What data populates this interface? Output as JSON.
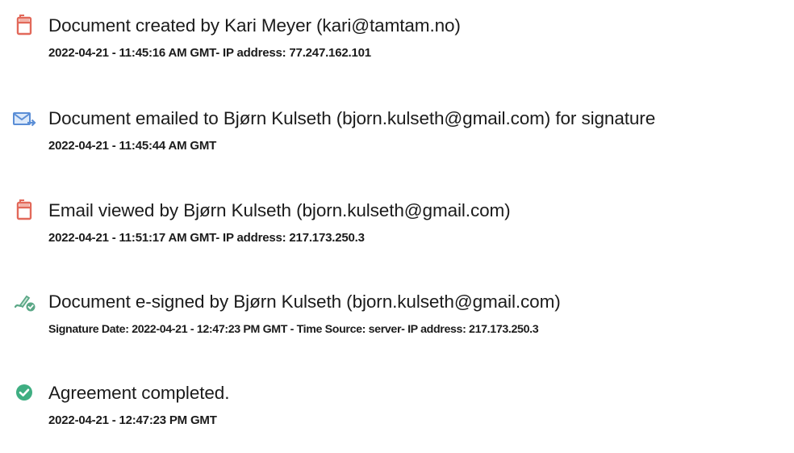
{
  "history": {
    "events": [
      {
        "icon": "document-created-icon",
        "title": "Document created by Kari Meyer (kari@tamtam.no)",
        "detail": "2022-04-21 - 11:45:16 AM GMT- IP address: 77.247.162.101"
      },
      {
        "icon": "email-sent-icon",
        "title": "Document emailed to Bjørn Kulseth (bjorn.kulseth@gmail.com) for signature",
        "detail": "2022-04-21 - 11:45:44 AM GMT"
      },
      {
        "icon": "email-viewed-icon",
        "title": "Email viewed by Bjørn Kulseth (bjorn.kulseth@gmail.com)",
        "detail": "2022-04-21 - 11:51:17 AM GMT- IP address: 217.173.250.3"
      },
      {
        "icon": "e-signed-icon",
        "title": "Document e-signed by Bjørn Kulseth (bjorn.kulseth@gmail.com)",
        "detail": "Signature Date: 2022-04-21 - 12:47:23 PM GMT - Time Source: server- IP address: 217.173.250.3"
      },
      {
        "icon": "agreement-completed-icon",
        "title": "Agreement completed.",
        "detail": "2022-04-21 - 12:47:23 PM GMT"
      }
    ]
  },
  "colors": {
    "doc_icon": "#e2695a",
    "mail_icon": "#5b8ed6",
    "sign_icon": "#5aa786",
    "check_icon": "#3fae82",
    "text": "#1b1b1b"
  }
}
